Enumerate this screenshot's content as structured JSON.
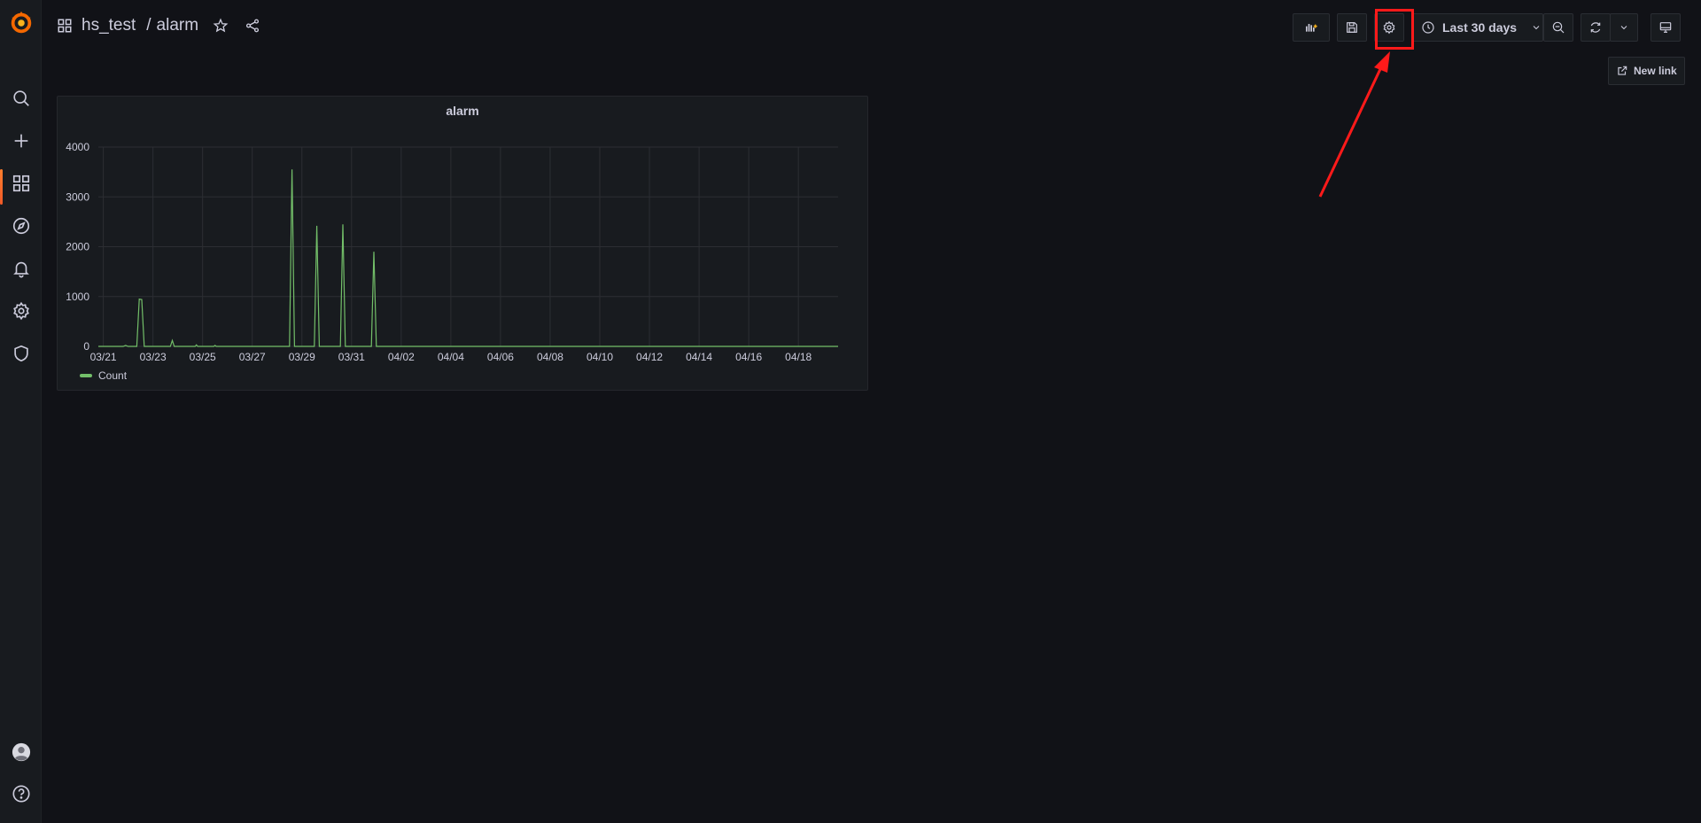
{
  "app": {
    "brand_color": "#f46800",
    "accent": "#73bf69"
  },
  "sidebar": {
    "items": [
      {
        "icon": "search-icon"
      },
      {
        "icon": "plus-icon"
      },
      {
        "icon": "dashboards-icon",
        "active": true
      },
      {
        "icon": "explore-compass-icon"
      },
      {
        "icon": "alerting-bell-icon"
      },
      {
        "icon": "configuration-gear-icon"
      },
      {
        "icon": "server-admin-shield-icon"
      }
    ],
    "bottom": [
      {
        "icon": "user-avatar-icon"
      },
      {
        "icon": "help-icon"
      }
    ]
  },
  "header": {
    "folder": "hs_test",
    "separator": "/",
    "dashboard": "alarm",
    "time_range": "Last 30 days"
  },
  "links": {
    "new_link": "New link"
  },
  "panel": {
    "title": "alarm",
    "legend": "Count"
  },
  "chart_data": {
    "type": "line",
    "title": "alarm",
    "x_ticks": [
      "03/21",
      "03/23",
      "03/25",
      "03/27",
      "03/29",
      "03/31",
      "04/02",
      "04/04",
      "04/06",
      "04/08",
      "04/10",
      "04/12",
      "04/14",
      "04/16",
      "04/18"
    ],
    "y_ticks": [
      "0",
      "1000",
      "2000",
      "3000",
      "4000"
    ],
    "ylim": [
      0,
      4000
    ],
    "xlim_days": [
      -0.2,
      29.6
    ],
    "grid": true,
    "legend_placement": "bottom-left",
    "series": [
      {
        "name": "Count",
        "color": "#73bf69",
        "points": [
          [
            -0.2,
            0
          ],
          [
            0.8,
            0
          ],
          [
            0.9,
            20
          ],
          [
            1.0,
            0
          ],
          [
            1.35,
            0
          ],
          [
            1.45,
            950
          ],
          [
            1.55,
            940
          ],
          [
            1.65,
            0
          ],
          [
            2.7,
            0
          ],
          [
            2.78,
            120
          ],
          [
            2.86,
            0
          ],
          [
            3.7,
            0
          ],
          [
            3.75,
            30
          ],
          [
            3.8,
            0
          ],
          [
            4.45,
            0
          ],
          [
            4.5,
            20
          ],
          [
            4.55,
            0
          ],
          [
            7.5,
            0
          ],
          [
            7.6,
            3550
          ],
          [
            7.7,
            0
          ],
          [
            8.5,
            0
          ],
          [
            8.6,
            2420
          ],
          [
            8.7,
            0
          ],
          [
            9.55,
            0
          ],
          [
            9.65,
            2450
          ],
          [
            9.75,
            0
          ],
          [
            10.8,
            0
          ],
          [
            10.9,
            1900
          ],
          [
            11.0,
            0
          ],
          [
            29.6,
            0
          ]
        ]
      }
    ]
  }
}
